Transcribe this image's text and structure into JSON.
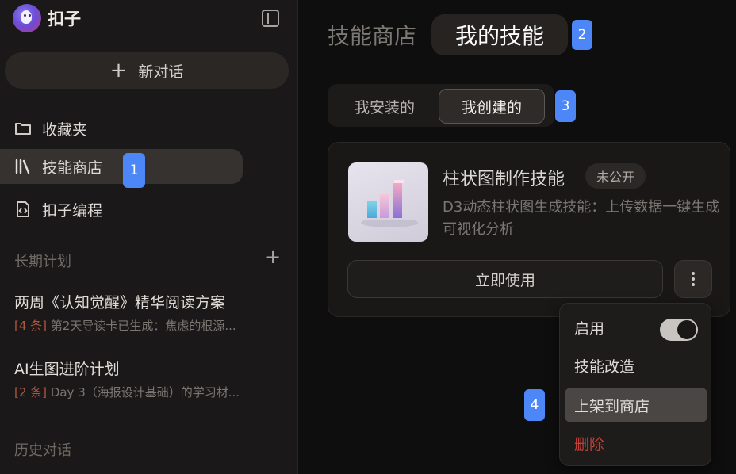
{
  "brand": {
    "name": "扣子"
  },
  "sidebar": {
    "new_chat": "新对话",
    "nav": [
      {
        "label": "收藏夹",
        "icon": "folder-icon"
      },
      {
        "label": "技能商店",
        "icon": "library-icon"
      },
      {
        "label": "扣子编程",
        "icon": "code-file-icon"
      }
    ],
    "long_term_title": "长期计划",
    "plans": [
      {
        "title": "两周《认知觉醒》精华阅读方案",
        "count": "[4 条]",
        "desc": "第2天导读卡已生成：焦虑的根源..."
      },
      {
        "title": "AI生图进阶计划",
        "count": "[2 条]",
        "desc": "Day 3（海报设计基础）的学习材..."
      }
    ],
    "history_title": "历史对话"
  },
  "main": {
    "tabs": [
      "技能商店",
      "我的技能"
    ],
    "segments": [
      "我安装的",
      "我创建的"
    ],
    "card": {
      "title": "柱状图制作技能",
      "badge": "未公开",
      "desc": "D3动态柱状图生成技能：上传数据一键生成可视化分析",
      "use_label": "立即使用"
    },
    "menu": {
      "enable_label": "启用",
      "enable_on": true,
      "items": [
        "技能改造",
        "上架到商店",
        "删除"
      ]
    }
  },
  "markers": [
    "1",
    "2",
    "3",
    "4"
  ],
  "colors": {
    "marker": "#4d86f7",
    "danger": "#c0413a",
    "plan_count": "#b0563f"
  }
}
